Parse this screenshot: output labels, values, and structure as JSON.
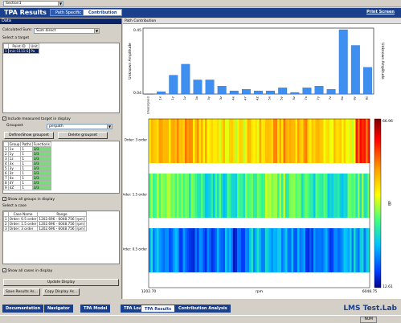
{
  "topbar": {
    "section_value": "Section1"
  },
  "app": {
    "title": "TPA Results"
  },
  "tabs": [
    {
      "label": "Path Specific"
    },
    {
      "label": "Contribution"
    }
  ],
  "header": {
    "print_screen": "Print Screen"
  },
  "left": {
    "data_header": "Data",
    "calculated_sum_label": "Calculated Sum:",
    "calculated_sum_value": "Sum direct",
    "select_target_label": "Select a target",
    "target_table": {
      "headers": [
        "",
        "Point ID",
        "Unit"
      ],
      "rows": [
        [
          "1",
          "mic:1111:S",
          "Pa"
        ]
      ]
    },
    "include_measured_label": "Include measured target in display",
    "groupset_label": "Groupset",
    "groupset_value": "perpath",
    "define_show_button": "Define/Show groupset",
    "delete_groupset_button": "Delete groupset",
    "groups_table": {
      "headers": [
        "",
        "Group",
        "Paths",
        "Functions"
      ],
      "rows": [
        [
          "1",
          "1x",
          "1",
          "3/3"
        ],
        [
          "2",
          "1y",
          "1",
          "3/3"
        ],
        [
          "3",
          "1z",
          "1",
          "3/3"
        ],
        [
          "4",
          "3x",
          "1",
          "3/3"
        ],
        [
          "5",
          "3y",
          "1",
          "3/3"
        ],
        [
          "6",
          "3z",
          "1",
          "3/3"
        ],
        [
          "7",
          "4x",
          "1",
          "3/3"
        ],
        [
          "8",
          "4Y",
          "1",
          "3/3"
        ],
        [
          "9",
          "4Z",
          "1",
          "3/3"
        ]
      ]
    },
    "show_all_groups_label": "Show all groups in display",
    "select_case_label": "Select a case",
    "case_table": {
      "headers": [
        "",
        "Case Name",
        "Range"
      ],
      "rows": [
        [
          "1",
          "Order: 0.5 order",
          "1202.696 - 6048.756 [rpm]"
        ],
        [
          "2",
          "Order: 1.5 order",
          "1202.696 - 6048.756 [rpm]"
        ],
        [
          "3",
          "Order: 3 order",
          "1202.696 - 6048.756 [rpm]"
        ]
      ]
    },
    "show_all_cases_label": "Show all cases in display",
    "update_display_button": "Update Display",
    "save_results_button": "Save Results As...",
    "copy_display_button": "Copy Display As..."
  },
  "chart_panel": {
    "title": "Path Contribution"
  },
  "chart_data": [
    {
      "type": "bar",
      "title": "Path Contribution",
      "ylabel": "Unknown Amplitude",
      "ylabel_right": "Unknown Amplitude",
      "ylim": [
        0.04,
        0.45
      ],
      "ytick_top": "0.45",
      "ytick_bottom": "0.04",
      "categories": [
        "Unassigned",
        "1x",
        "1y",
        "1z",
        "3x",
        "3y",
        "3z",
        "4x",
        "4Y",
        "4Z",
        "5x",
        "5y",
        "5z",
        "7x",
        "7y",
        "7z",
        "8x",
        "8y",
        "8z"
      ],
      "values": [
        0.04,
        0.055,
        0.16,
        0.23,
        0.13,
        0.13,
        0.09,
        0.06,
        0.07,
        0.06,
        0.06,
        0.08,
        0.05,
        0.08,
        0.09,
        0.07,
        0.45,
        0.35,
        0.21
      ]
    },
    {
      "type": "heatmap",
      "rows": [
        "Order: 3 order",
        "Order: 1.5 order",
        "Order: 0.5 order"
      ],
      "x_start": "1202.70",
      "x_end": "6048.75",
      "xlabel": "rpm",
      "colorbar_top": "66.96",
      "colorbar_bottom": "12.61",
      "colorbar_unit": "dB"
    }
  ],
  "bottom_nav": [
    {
      "label": "Documentation"
    },
    {
      "label": "Navigator"
    },
    {
      "label": "TPA Model"
    },
    {
      "label": "TPA Loads"
    },
    {
      "label": "TPA Results"
    },
    {
      "label": "Contribution Analysis"
    }
  ],
  "brand": {
    "name": "LMS Test.Lab"
  },
  "status": {
    "num": "NUM"
  }
}
